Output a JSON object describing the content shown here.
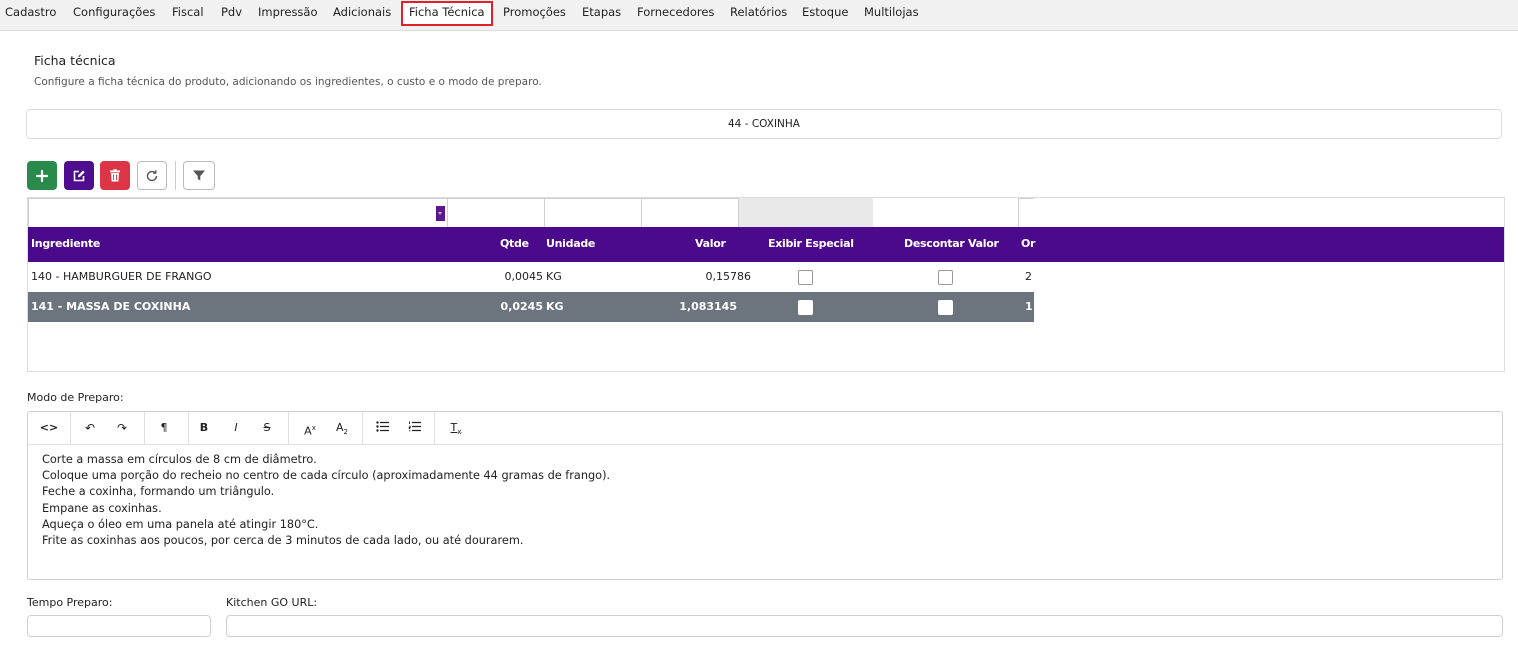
{
  "tabs": [
    {
      "label": "Cadastro",
      "active": false
    },
    {
      "label": "Configurações",
      "active": false
    },
    {
      "label": "Fiscal",
      "active": false
    },
    {
      "label": "Pdv",
      "active": false
    },
    {
      "label": "Impressão",
      "active": false
    },
    {
      "label": "Adicionais",
      "active": false
    },
    {
      "label": "Ficha Técnica",
      "active": true
    },
    {
      "label": "Promoções",
      "active": false
    },
    {
      "label": "Etapas",
      "active": false
    },
    {
      "label": "Fornecedores",
      "active": false
    },
    {
      "label": "Relatórios",
      "active": false
    },
    {
      "label": "Estoque",
      "active": false
    },
    {
      "label": "Multilojas",
      "active": false
    }
  ],
  "header": {
    "title": "Ficha técnica",
    "subtitle": "Configure a ficha técnica do produto, adicionando os ingredientes, o custo e o modo de preparo."
  },
  "product": "44 - COXINHA",
  "toolbar": {
    "add_icon": "plus-icon",
    "edit_icon": "edit-icon",
    "delete_icon": "trash-icon",
    "refresh_icon": "refresh-icon",
    "filter_icon": "filter-icon"
  },
  "grid": {
    "columns": [
      "Ingrediente",
      "Qtde",
      "Unidade",
      "Valor",
      "Exibir Especial",
      "Descontar Valor",
      "Or"
    ],
    "rows": [
      {
        "ingrediente": "140 - HAMBURGUER DE FRANGO",
        "qtde": "0,0045",
        "unidade": "KG",
        "valor": "0,15786",
        "exibir_especial": false,
        "descontar_valor": false,
        "or": "2",
        "selected": false
      },
      {
        "ingrediente": "141 - MASSA DE COXINHA",
        "qtde": "0,0245",
        "unidade": "KG",
        "valor": "1,083145",
        "exibir_especial": false,
        "descontar_valor": false,
        "or": "1",
        "selected": true
      }
    ]
  },
  "preparo": {
    "label": "Modo de Preparo:",
    "toolbar": {
      "code": "<>",
      "undo": "↶",
      "redo": "↷",
      "paragraph": "¶",
      "bold": "B",
      "italic": "I",
      "strike": "S",
      "sup": "A",
      "sub": "A",
      "clear": "T"
    },
    "lines": [
      "Corte a massa em círculos de 8 cm de diâmetro.",
      "Coloque uma porção do recheio no centro de cada círculo (aproximadamente 44 gramas de frango).",
      "Feche a coxinha, formando um triângulo.",
      "Empane as coxinhas.",
      "Aqueça o óleo em uma panela até atingir 180°C.",
      "Frite as coxinhas aos poucos, por cerca de 3 minutos de cada lado, ou até dourarem."
    ]
  },
  "fields": {
    "tempo_label": "Tempo Preparo:",
    "tempo_value": "",
    "kitchen_label": "Kitchen GO URL:",
    "kitchen_value": ""
  }
}
